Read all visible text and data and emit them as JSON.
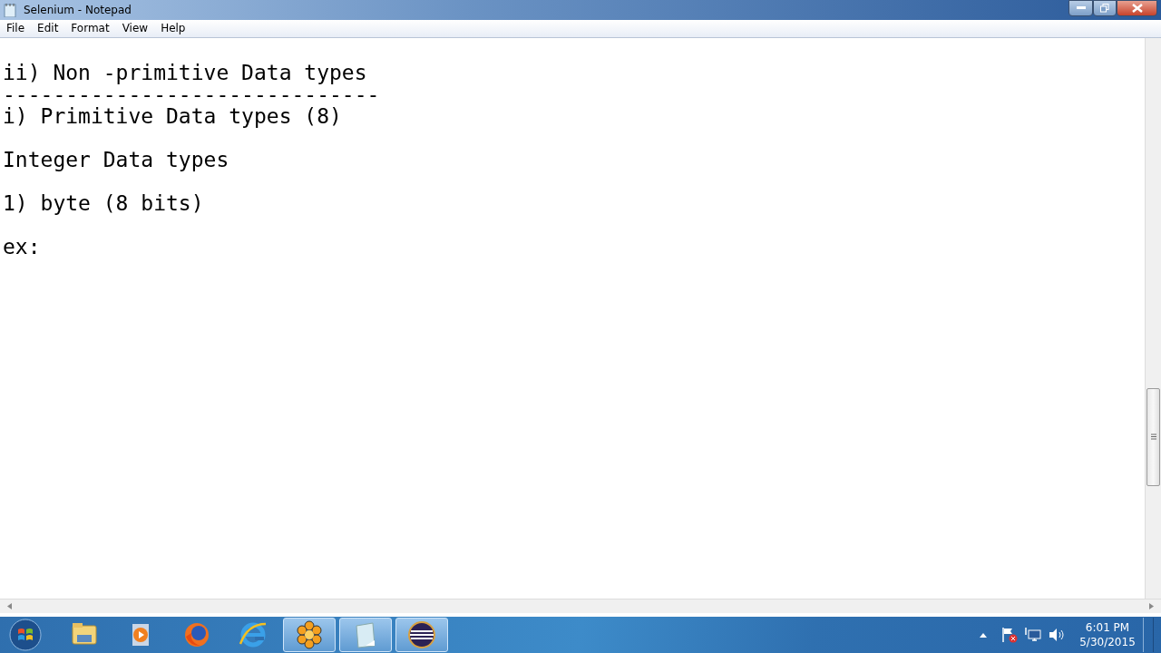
{
  "window": {
    "title": "Selenium - Notepad"
  },
  "menu": [
    "File",
    "Edit",
    "Format",
    "View",
    "Help"
  ],
  "editor": {
    "lines": [
      {
        "text": "ii) Non -primitive Data types",
        "spaced": false
      },
      {
        "text": "------------------------------",
        "spaced": false
      },
      {
        "text": "i) Primitive Data types (8)",
        "spaced": false
      },
      {
        "text": "Integer Data types",
        "spaced": true
      },
      {
        "text": "1) byte (8 bits)",
        "spaced": true
      },
      {
        "text": "ex:",
        "spaced": true
      }
    ]
  },
  "taskbar": {
    "apps": [
      {
        "kind": "folder",
        "running": false
      },
      {
        "kind": "player",
        "running": false
      },
      {
        "kind": "firefox",
        "running": false
      },
      {
        "kind": "ie",
        "running": false
      },
      {
        "kind": "flower",
        "running": true
      },
      {
        "kind": "notepad",
        "running": true
      },
      {
        "kind": "eclipse",
        "running": true
      }
    ],
    "clock": {
      "time": "6:01 PM",
      "date": "5/30/2015"
    }
  }
}
